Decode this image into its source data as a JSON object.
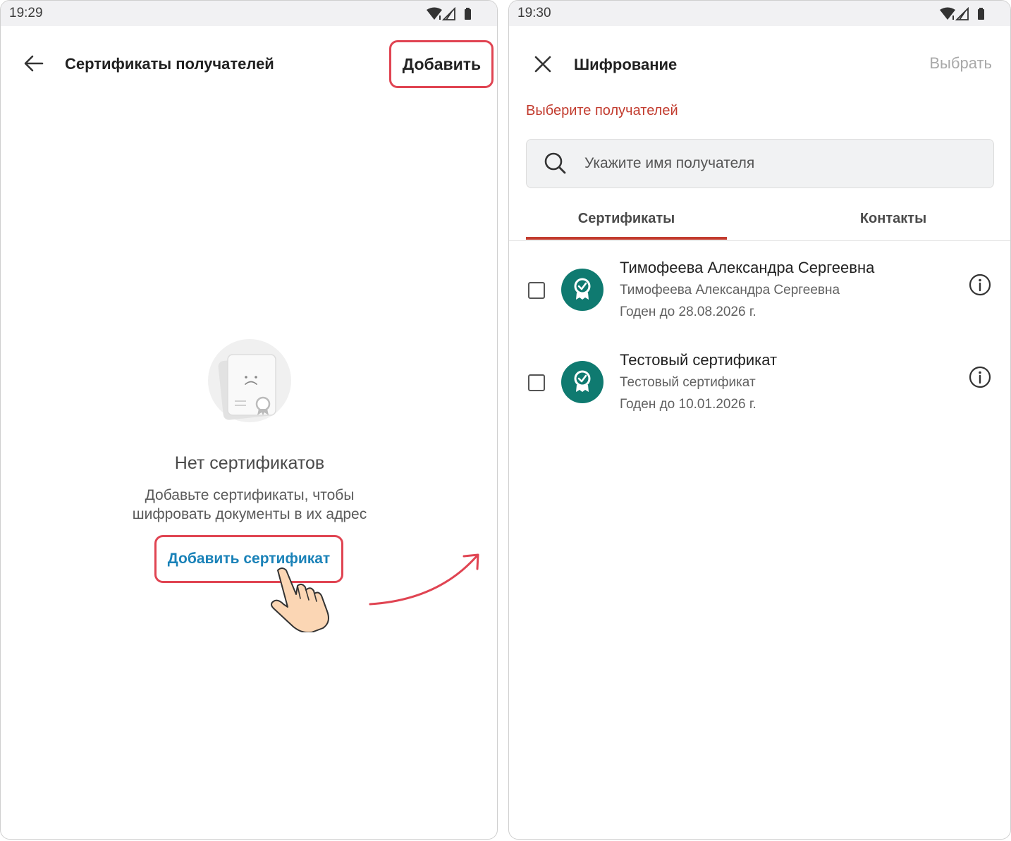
{
  "left": {
    "status_time": "19:29",
    "title": "Сертификаты получателей",
    "add_label": "Добавить",
    "empty_title": "Нет сертификатов",
    "empty_desc_line1": "Добавьте сертификаты, чтобы",
    "empty_desc_line2": "шифровать документы в их адрес",
    "add_cert_label": "Добавить сертификат"
  },
  "right": {
    "status_time": "19:30",
    "title": "Шифрование",
    "select_label": "Выбрать",
    "section_label": "Выберите получателей",
    "search_placeholder": "Укажите имя получателя",
    "tabs": [
      {
        "label": "Сертификаты",
        "active": true
      },
      {
        "label": "Контакты",
        "active": false
      }
    ],
    "certificates": [
      {
        "name": "Тимофеева Александра Сергеевна",
        "subject": "Тимофеева Александра Сергеевна",
        "valid": "Годен до 28.08.2026 г.",
        "checked": false
      },
      {
        "name": "Тестовый сертификат",
        "subject": "Тестовый сертификат",
        "valid": "Годен до 10.01.2026 г.",
        "checked": false
      }
    ]
  },
  "colors": {
    "accent_red": "#c23b2e",
    "highlight": "#e04452",
    "link_blue": "#1a82b8",
    "avatar_teal": "#0f7a70"
  },
  "icons": [
    "back-arrow-icon",
    "close-icon",
    "search-icon",
    "certificate-avatar-icon",
    "info-icon",
    "wifi-icon",
    "signal-icon",
    "battery-icon",
    "empty-certificate-icon",
    "pointing-hand-icon",
    "curved-arrow-icon"
  ]
}
